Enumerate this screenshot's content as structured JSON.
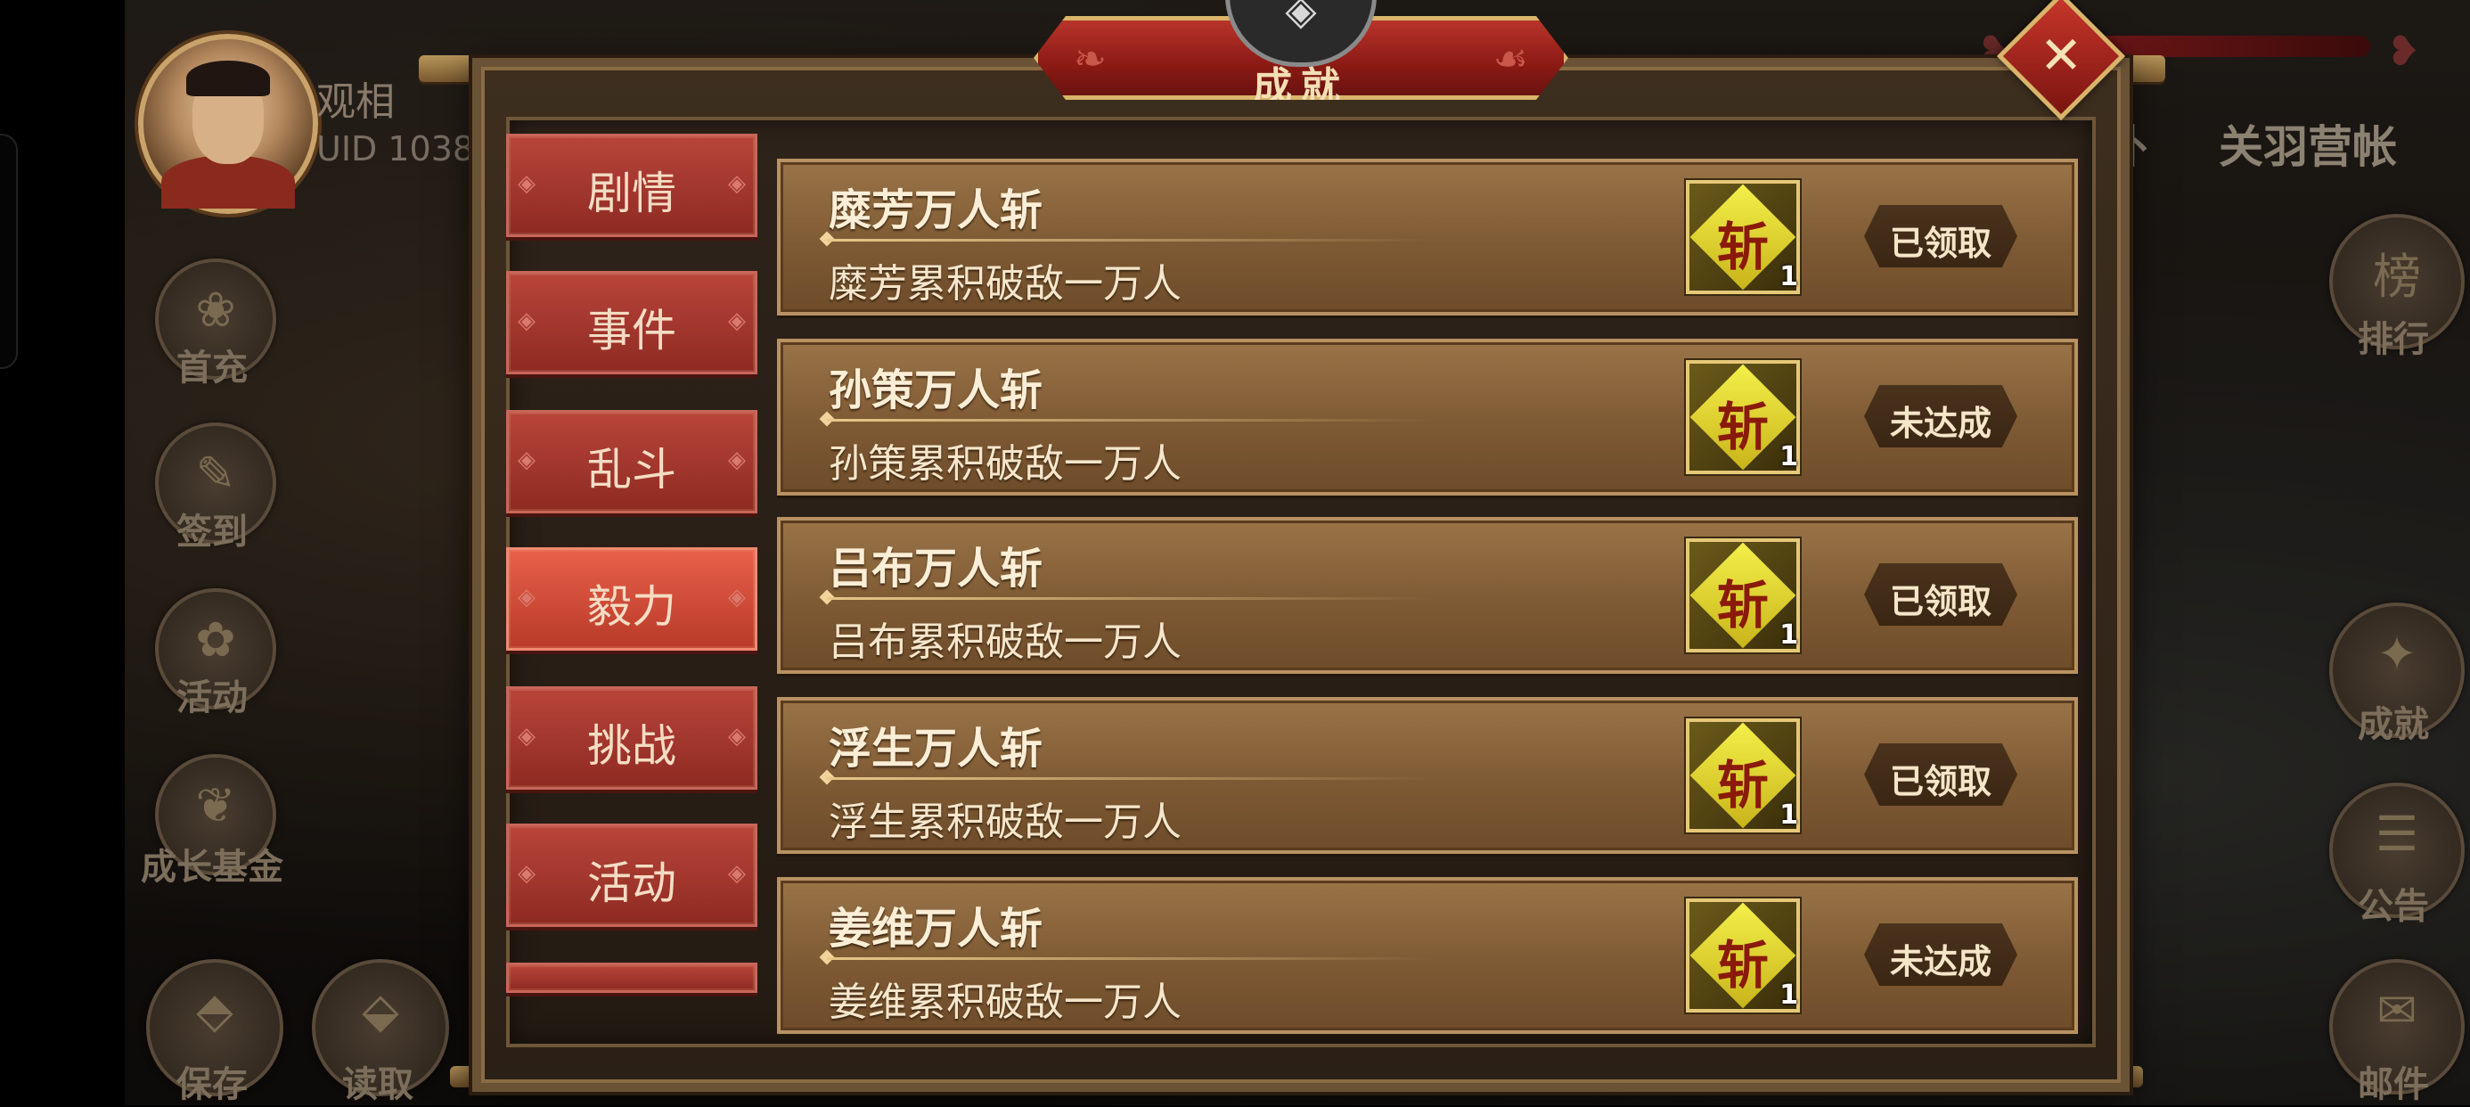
{
  "player": {
    "name": "观相",
    "uid": "UID  1038"
  },
  "side_left": [
    {
      "label": "首充",
      "icon": "gift-icon"
    },
    {
      "label": "签到",
      "icon": "scroll-icon"
    },
    {
      "label": "活动",
      "icon": "flower-icon"
    },
    {
      "label": "成长基金",
      "icon": "plant-icon"
    }
  ],
  "bottom_left": [
    {
      "label": "保存",
      "icon": "save-icon"
    },
    {
      "label": "读取",
      "icon": "load-icon"
    }
  ],
  "side_right": [
    {
      "label": "排行",
      "icon": "ranking-icon"
    },
    {
      "label": "成就",
      "icon": "achievement-icon"
    },
    {
      "label": "公告",
      "icon": "notice-icon"
    },
    {
      "label": "邮件",
      "icon": "mail-icon"
    }
  ],
  "scene_tabs": {
    "partial": "外",
    "camp": "关羽营帐"
  },
  "modal": {
    "title": "成就",
    "close": "✕",
    "tabs": [
      {
        "label": "剧情",
        "active": false
      },
      {
        "label": "事件",
        "active": false
      },
      {
        "label": "乱斗",
        "active": false
      },
      {
        "label": "毅力",
        "active": true
      },
      {
        "label": "挑战",
        "active": false
      },
      {
        "label": "活动",
        "active": false
      }
    ],
    "achievements": [
      {
        "title": "糜芳万人斩",
        "desc": "糜芳累积破敌一万人",
        "reward_glyph": "斩",
        "reward_qty": "1",
        "status": "已领取"
      },
      {
        "title": "孙策万人斩",
        "desc": "孙策累积破敌一万人",
        "reward_glyph": "斩",
        "reward_qty": "1",
        "status": "未达成"
      },
      {
        "title": "吕布万人斩",
        "desc": "吕布累积破敌一万人",
        "reward_glyph": "斩",
        "reward_qty": "1",
        "status": "已领取"
      },
      {
        "title": "浮生万人斩",
        "desc": "浮生累积破敌一万人",
        "reward_glyph": "斩",
        "reward_qty": "1",
        "status": "已领取"
      },
      {
        "title": "姜维万人斩",
        "desc": "姜维累积破敌一万人",
        "reward_glyph": "斩",
        "reward_qty": "1",
        "status": "未达成"
      }
    ]
  }
}
